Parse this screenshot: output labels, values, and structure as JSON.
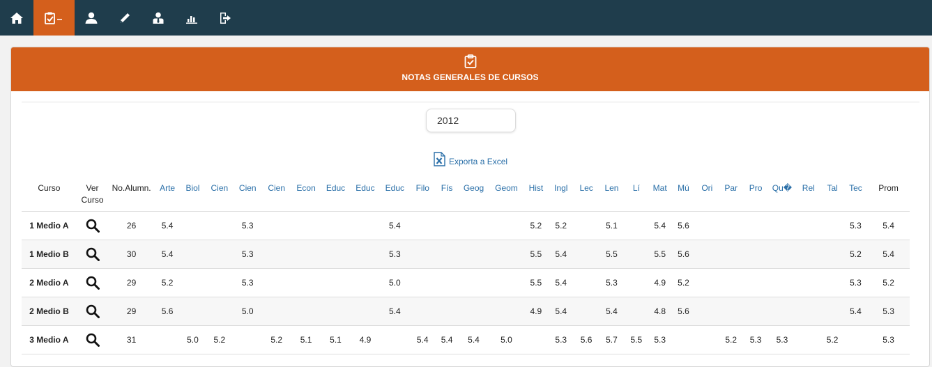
{
  "nav": {
    "items": [
      {
        "name": "home-icon",
        "active": false
      },
      {
        "name": "clipboard-check-icon",
        "active": true,
        "suffix": "–"
      },
      {
        "name": "user-icon",
        "active": false
      },
      {
        "name": "pencil-icon",
        "active": false
      },
      {
        "name": "user-tie-icon",
        "active": false
      },
      {
        "name": "bar-chart-icon",
        "active": false
      },
      {
        "name": "logout-icon",
        "active": false
      }
    ]
  },
  "colors": {
    "nav_bg": "#1f3d4c",
    "accent": "#d45f1c",
    "link": "#2a6fa8"
  },
  "panel": {
    "title": "NOTAS GENERALES DE CURSOS"
  },
  "year_value": "2012",
  "export_label": "Exporta a Excel",
  "table": {
    "headers": {
      "curso": "Curso",
      "ver_curso": "Ver Curso",
      "alumnos": "No.Alumn.",
      "subjects": [
        "Arte",
        "Biol",
        "Cien",
        "Cien",
        "Cien",
        "Econ",
        "Educ",
        "Educ",
        "Educ",
        "Filo",
        "Fís",
        "Geog",
        "Geom",
        "Hist",
        "Ingl",
        "Lec",
        "Len",
        "Lí",
        "Mat",
        "Mú",
        "Ori",
        "Par",
        "Pro",
        "Qu�",
        "Rel",
        "Tal",
        "Tec"
      ],
      "prom": "Prom"
    },
    "rows": [
      {
        "curso": "1 Medio A",
        "alumnos": "26",
        "grades": [
          "5.4",
          "",
          "",
          "5.3",
          "",
          "",
          "",
          "",
          "5.4",
          "",
          "",
          "",
          "",
          "5.2",
          "5.2",
          "",
          "5.1",
          "",
          "5.4",
          "5.6",
          "",
          "",
          "",
          "",
          "",
          "",
          "5.3"
        ],
        "prom": "5.4"
      },
      {
        "curso": "1 Medio B",
        "alumnos": "30",
        "grades": [
          "5.4",
          "",
          "",
          "5.3",
          "",
          "",
          "",
          "",
          "5.3",
          "",
          "",
          "",
          "",
          "5.5",
          "5.4",
          "",
          "5.5",
          "",
          "5.5",
          "5.6",
          "",
          "",
          "",
          "",
          "",
          "",
          "5.2"
        ],
        "prom": "5.4"
      },
      {
        "curso": "2 Medio A",
        "alumnos": "29",
        "grades": [
          "5.2",
          "",
          "",
          "5.3",
          "",
          "",
          "",
          "",
          "5.0",
          "",
          "",
          "",
          "",
          "5.5",
          "5.4",
          "",
          "5.3",
          "",
          "4.9",
          "5.2",
          "",
          "",
          "",
          "",
          "",
          "",
          "5.3"
        ],
        "prom": "5.2"
      },
      {
        "curso": "2 Medio B",
        "alumnos": "29",
        "grades": [
          "5.6",
          "",
          "",
          "5.0",
          "",
          "",
          "",
          "",
          "5.4",
          "",
          "",
          "",
          "",
          "4.9",
          "5.4",
          "",
          "5.4",
          "",
          "4.8",
          "5.6",
          "",
          "",
          "",
          "",
          "",
          "",
          "5.4"
        ],
        "prom": "5.3"
      },
      {
        "curso": "3 Medio A",
        "alumnos": "31",
        "grades": [
          "",
          "5.0",
          "5.2",
          "",
          "5.2",
          "5.1",
          "5.1",
          "4.9",
          "",
          "5.4",
          "5.4",
          "5.4",
          "5.0",
          "",
          "5.3",
          "5.6",
          "5.7",
          "5.5",
          "5.3",
          "",
          "",
          "5.2",
          "5.3",
          "5.3",
          "",
          "5.2",
          ""
        ],
        "prom": "5.3"
      }
    ]
  }
}
